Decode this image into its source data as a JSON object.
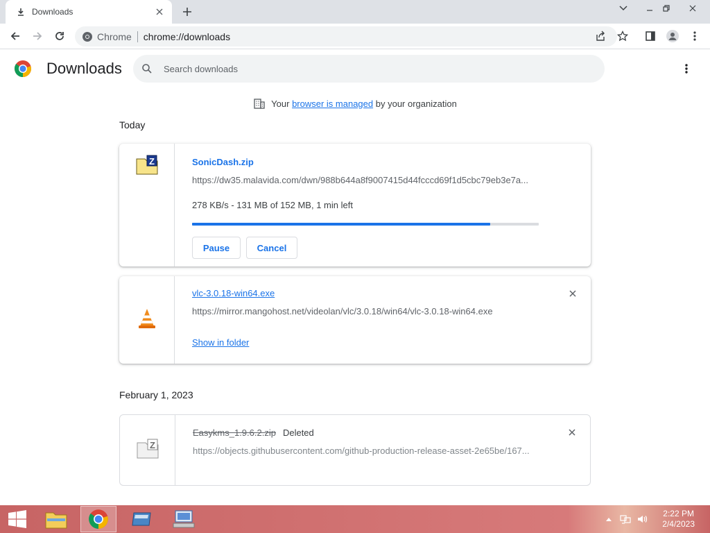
{
  "browser": {
    "tab_title": "Downloads",
    "omnibox_site": "Chrome",
    "omnibox_url": "chrome://downloads"
  },
  "page": {
    "title": "Downloads",
    "search_placeholder": "Search downloads",
    "managed_prefix": "Your",
    "managed_link": "browser is managed",
    "managed_suffix": "by your organization"
  },
  "groups": [
    {
      "date": "Today"
    },
    {
      "date": "February 1, 2023"
    }
  ],
  "downloads": [
    {
      "name": "SonicDash.zip",
      "url": "https://dw35.malavida.com/dwn/988b644a8f9007415d44fcccd69f1d5cbc79eb3e7a...",
      "status": "278 KB/s - 131 MB of 152 MB, 1 min left",
      "progress": 0.86,
      "pause_label": "Pause",
      "cancel_label": "Cancel",
      "icon": "zip-file-icon"
    },
    {
      "name": "vlc-3.0.18-win64.exe",
      "url": "https://mirror.mangohost.net/videolan/vlc/3.0.18/win64/vlc-3.0.18-win64.exe",
      "action_label": "Show in folder",
      "icon": "vlc-cone-icon"
    },
    {
      "name": "Easykms_1.9.6.2.zip",
      "deleted_label": "Deleted",
      "url": "https://objects.githubusercontent.com/github-production-release-asset-2e65be/167...",
      "icon": "zip-file-icon"
    }
  ],
  "taskbar": {
    "time": "2:22 PM",
    "date": "2/4/2023"
  },
  "colors": {
    "accent": "#1a73e8",
    "taskbar": "#c76464"
  }
}
